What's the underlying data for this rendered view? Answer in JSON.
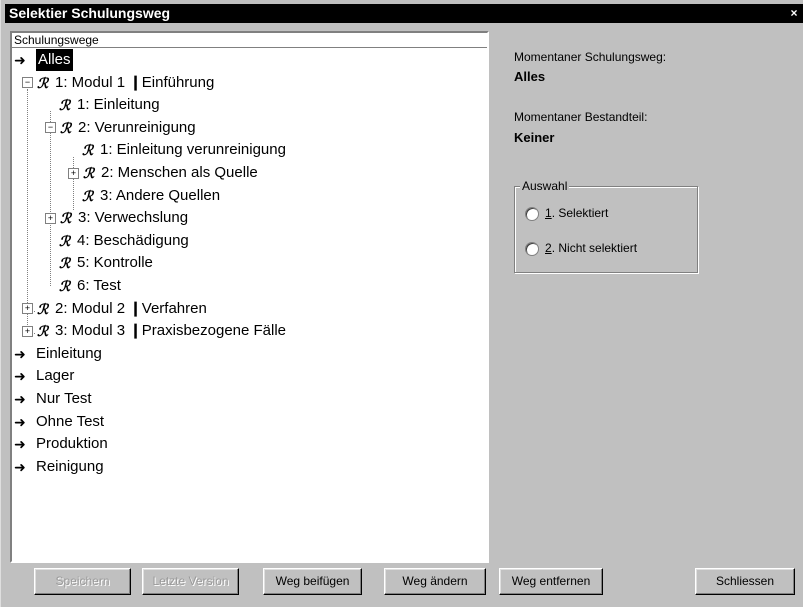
{
  "window": {
    "title": "Selektier Schulungsweg",
    "close_glyph": "×"
  },
  "tree": {
    "header": "Schulungswege",
    "items": [
      {
        "label": "Alles",
        "icon": "arrow-icon",
        "selected": true
      },
      {
        "label": "1: Modul 1 ❙Einführung",
        "icon": "figure-icon",
        "toggle": "−"
      },
      {
        "label": "1: Einleitung",
        "icon": "figure-icon"
      },
      {
        "label": "2: Verunreinigung",
        "icon": "figure-icon",
        "toggle": "−"
      },
      {
        "label": "1: Einleitung verunreinigung",
        "icon": "figure-icon"
      },
      {
        "label": "2: Menschen als Quelle",
        "icon": "figure-icon",
        "toggle": "+"
      },
      {
        "label": "3: Andere Quellen",
        "icon": "figure-icon"
      },
      {
        "label": "3: Verwechslung",
        "icon": "figure-icon",
        "toggle": "+"
      },
      {
        "label": "4: Beschädigung",
        "icon": "figure-icon"
      },
      {
        "label": "5: Kontrolle",
        "icon": "figure-icon"
      },
      {
        "label": "6: Test",
        "icon": "figure-icon"
      },
      {
        "label": "2: Modul 2 ❙Verfahren",
        "icon": "figure-icon",
        "toggle": "+"
      },
      {
        "label": "3: Modul 3 ❙Praxisbezogene Fälle",
        "icon": "figure-icon",
        "toggle": "+"
      },
      {
        "label": "Einleitung",
        "icon": "arrow-icon"
      },
      {
        "label": "Lager",
        "icon": "arrow-icon"
      },
      {
        "label": "Nur Test",
        "icon": "arrow-icon"
      },
      {
        "label": "Ohne Test",
        "icon": "arrow-icon"
      },
      {
        "label": "Produktion",
        "icon": "arrow-icon"
      },
      {
        "label": "Reinigung",
        "icon": "arrow-icon"
      }
    ]
  },
  "info": {
    "current_path_label": "Momentaner Schulungsweg:",
    "current_path_value": "Alles",
    "current_part_label": "Momentaner Bestandteil:",
    "current_part_value": "Keiner"
  },
  "selection": {
    "title": "Auswahl",
    "options": [
      {
        "num": "1",
        "rest": ". Selektiert"
      },
      {
        "num": "2",
        "rest": ". Nicht selektiert"
      }
    ]
  },
  "buttons": {
    "save": "Speichern",
    "last_version": "Letzte Version",
    "add_path": "Weg beifügen",
    "change_path": "Weg ändern",
    "remove_path": "Weg entfernen",
    "close": "Schliessen"
  },
  "glyphs": {
    "arrow": "➜",
    "figure": "ℛ"
  }
}
